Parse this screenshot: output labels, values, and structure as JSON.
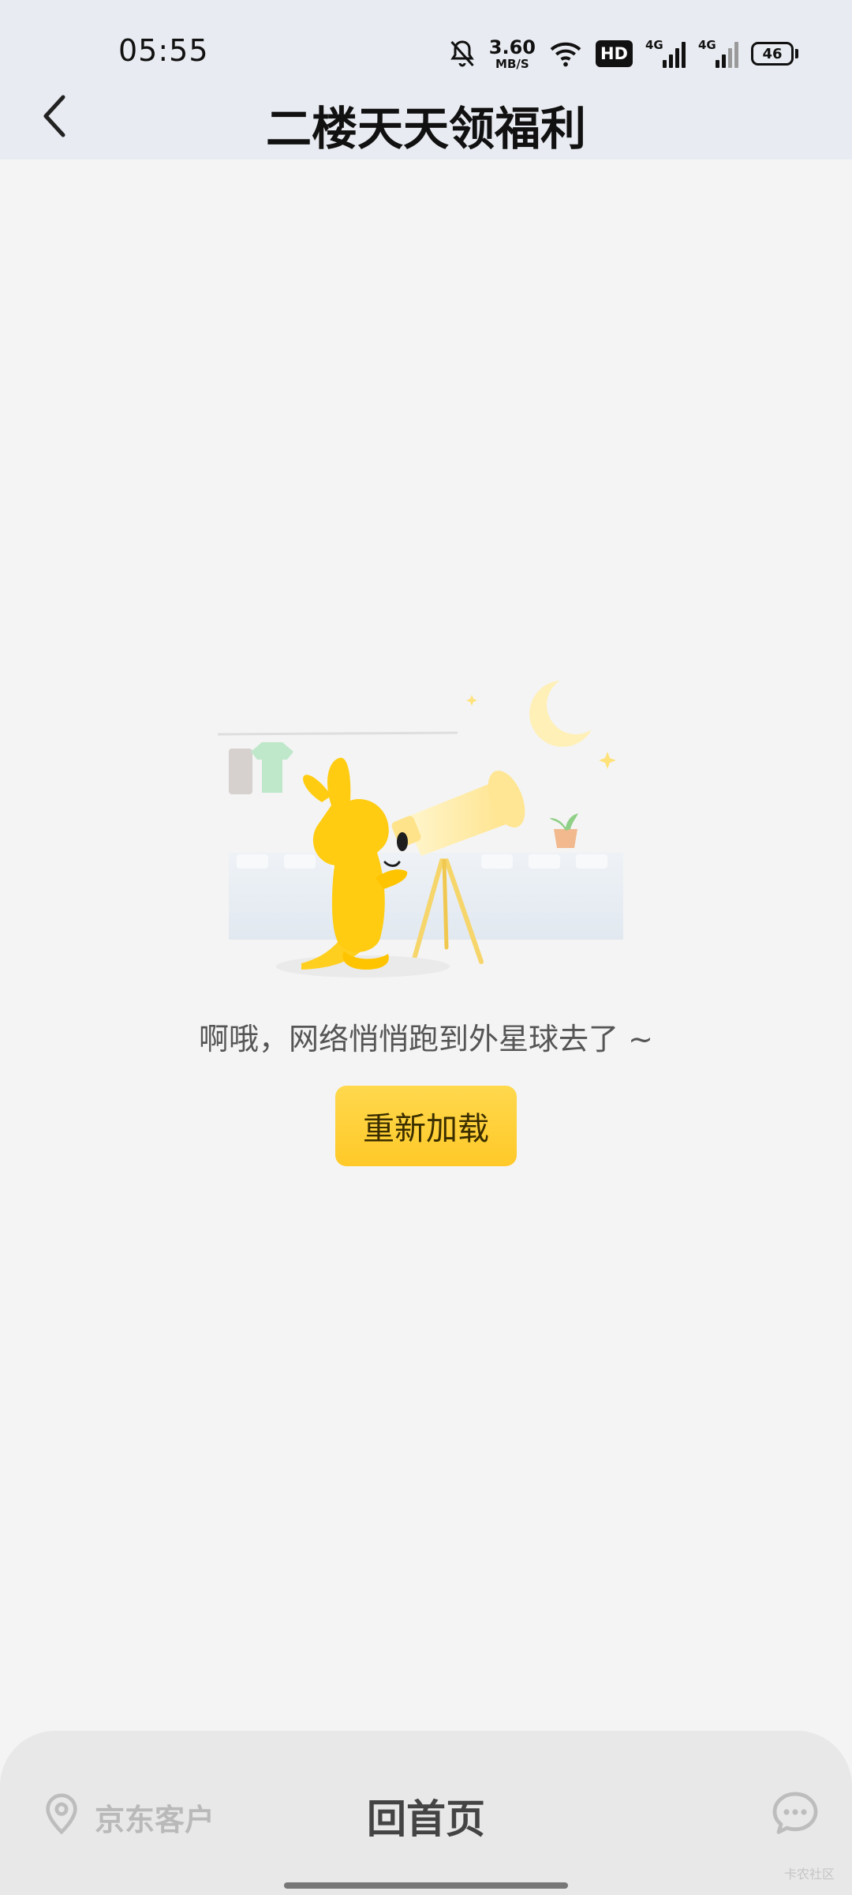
{
  "status_bar": {
    "time": "05:55",
    "speed_value": "3.60",
    "speed_unit": "MB/S",
    "hd_label": "HD",
    "network_1": "4G",
    "network_2": "4G",
    "battery": "46"
  },
  "nav": {
    "title": "二楼天天领福利"
  },
  "main": {
    "error_message": "啊哦，网络悄悄跑到外星球去了 ~",
    "reload_button": "重新加载"
  },
  "bottom_bar": {
    "customer_label": "京东客户",
    "home_label": "回首页"
  },
  "watermark": "卡农社区",
  "colors": {
    "accent": "#ffcc33",
    "header_bg": "#e8ebf1",
    "page_bg": "#f4f4f4"
  }
}
